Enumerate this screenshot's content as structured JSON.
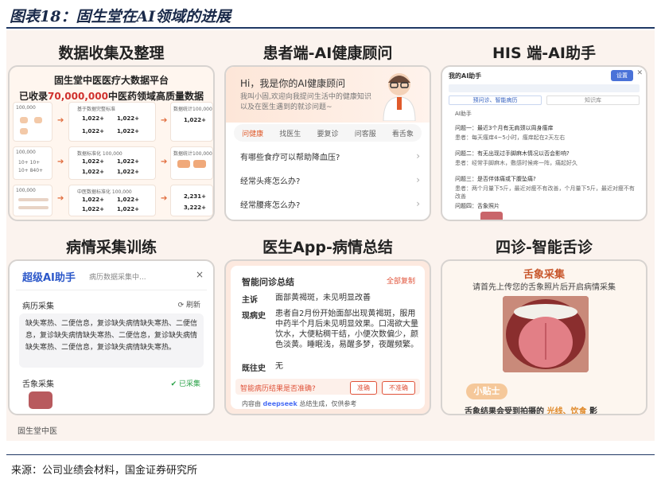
{
  "figure_title": "图表18：固生堂在AI领域的进展",
  "source": "来源：公司业绩会材料，国金证券研究所",
  "stamp": "固生堂中医",
  "captions": [
    "数据收集及整理",
    "患者端-AI健康顾问",
    "HIS 端-AI助手",
    "病情采集训练",
    "医生App-病情总结",
    "四诊-智能舌诊"
  ],
  "panel1": {
    "line1": "固生堂中医医疗大数据平台",
    "line2_prefix": "已收录",
    "line2_number": "70,000,000",
    "line2_suffix": "中医药领域高质量数据",
    "rows": [
      {
        "left": "100,000",
        "a": "1,022+",
        "b": "1,022+",
        "c": "1,022+",
        "d": "1,022+",
        "right": "1,022+",
        "right_top": "数据统计100,000"
      },
      {
        "left": "100,000",
        "a": "1,022+",
        "b": "1,022+",
        "c": "1,022+",
        "d": "1,022+",
        "right": "1,022+",
        "right_top": "数据统计100,000"
      },
      {
        "left": "100,000",
        "a": "1,022+",
        "b": "1,022+",
        "c": "1,022+",
        "d": "1,022+",
        "right": "3,222+",
        "right_top": "2,231+"
      }
    ]
  },
  "panel2": {
    "greeting": "Hi，我是你的AI健康顾问",
    "intro": "我叫小固,欢迎向我提问生活中的健康知识以及在医生遇到的就诊问题~",
    "tabs": [
      "问健康",
      "找医生",
      "要复诊",
      "问客服",
      "看舌象"
    ],
    "questions": [
      "有哪些食疗可以帮助降血压?",
      "经常头疼怎么办?",
      "经常腰疼怎么办?"
    ]
  },
  "panel3": {
    "title": "我的AI助手",
    "send": "设置",
    "close": "✕",
    "tabs": [
      "预问诊、智能病历",
      "知识库"
    ],
    "label": "AI助手",
    "items": [
      {
        "q": "问题一：最近3个月有无肩颈以周身瘙痒",
        "a": "患者：每天瘙痒4~5小时，瘙痒起在2天左右"
      },
      {
        "q": "问题二：有无出现过手脚麻木情况以否会影响?",
        "a": "患者：经常手脚麻木，敷感时候疼一阵，痛起好久"
      },
      {
        "q": "问题三：是否伴体痛或下腹坠痛?",
        "a": "患者：两个月量下5斤，最近对瘦不有改善，个月量下5斤，最近对瘦不有改善"
      },
      {
        "q": "问题四：舌象照片",
        "a": ""
      }
    ]
  },
  "panel4": {
    "title": "超级AI助手",
    "subtitle": "病历数据采集中...",
    "close": "×",
    "section1": "病历采集",
    "refresh": "刷新",
    "text": "缺失寒热、二便信息，复诊缺失病情缺失寒热、二便信息，复诊缺失病情缺失寒热、二便信息，复诊缺失病情缺失寒热、二便信息，复诊缺失病情缺失寒热。",
    "section2": "舌象采集",
    "status": "已采集"
  },
  "panel5": {
    "title": "智能问诊总结",
    "copy": "全部复制",
    "fields": [
      {
        "k": "主诉",
        "v": "面部黄褐斑，未见明显改善"
      },
      {
        "k": "现病史",
        "v": "患者自2月份开始面部出现黄褐斑，服用中药半个月后未见明显效果。口渴欲大量饮水，大便粘稠干结，小便次数偏少，颜色淡黄。睡眠浅，易醒多梦，夜醒频繁。"
      },
      {
        "k": "既往史",
        "v": "无"
      }
    ],
    "ask": "智能病历结果是否准确?",
    "yes": "准确",
    "no": "不准确",
    "gen_prefix": "内容由",
    "gen_brand": "deepseek",
    "gen_suffix": "总结生成，仅供参考"
  },
  "panel6": {
    "title": "舌象采集",
    "instruction": "请首先上传您的舌象照片后开启病情采集",
    "tip": "小贴士",
    "warn_prefix": "舌象结果会受到拍摄的",
    "warn_highlight": "光线、饮食",
    "warn_suffix": "影"
  }
}
